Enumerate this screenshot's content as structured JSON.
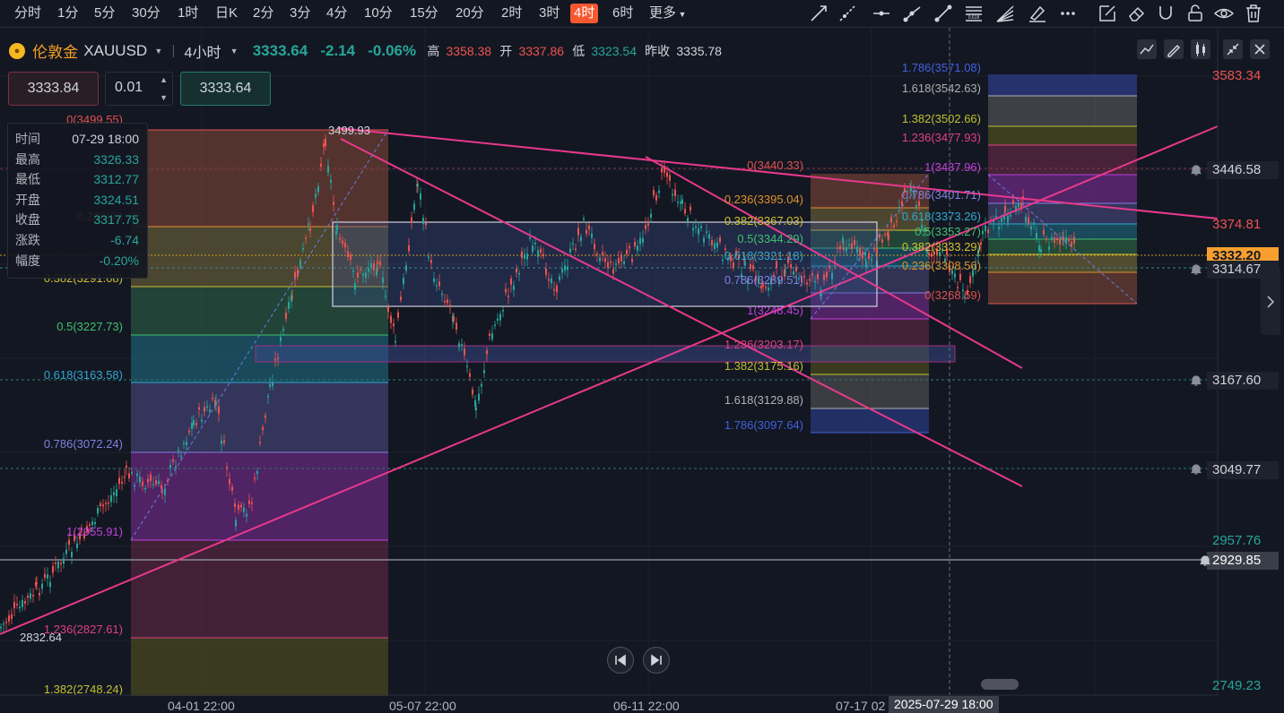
{
  "toolbar": {
    "timeframes": [
      "分时",
      "1分",
      "5分",
      "30分",
      "1时",
      "日K",
      "2分",
      "3分",
      "4分",
      "10分",
      "15分",
      "20分",
      "2时",
      "3时",
      "4时",
      "6时",
      "更多"
    ],
    "active_timeframe": "4时"
  },
  "symbol": {
    "name": "伦敦金",
    "code": "XAUUSD",
    "interval": "4小时",
    "price": "3333.64",
    "change": "-2.14",
    "change_pct": "-0.06%",
    "high_label": "高",
    "high": "3358.38",
    "open_label": "开",
    "open": "3337.86",
    "low_label": "低",
    "low": "3323.54",
    "prev_close_label": "昨收",
    "prev_close": "3335.78"
  },
  "trade": {
    "sell_price": "3333.84",
    "lot": "0.01",
    "buy_price": "3333.64"
  },
  "ohlc_panel": {
    "rows": [
      {
        "k": "时间",
        "v": "07-29 18:00"
      },
      {
        "k": "最高",
        "v": "3326.33"
      },
      {
        "k": "最低",
        "v": "3312.77"
      },
      {
        "k": "开盘",
        "v": "3324.51"
      },
      {
        "k": "收盘",
        "v": "3317.75"
      },
      {
        "k": "涨跌",
        "v": "-6.74"
      },
      {
        "k": "幅度",
        "v": "-0.20%"
      }
    ]
  },
  "price_axis": {
    "top": "3583.34",
    "alert1": "3446.58",
    "level_red": "3374.81",
    "current": "3332.20",
    "alert2": "3314.67",
    "alert3": "3167.60",
    "alert4": "3049.77",
    "green1": "2957.76",
    "alert5": "2929.85",
    "bottom": "2749.23"
  },
  "time_axis": {
    "labels": [
      "04-01 22:00",
      "05-07 22:00",
      "06-11 22:00",
      "07-17 02"
    ],
    "crosshair": "2025-07-29 18:00"
  },
  "annotations": {
    "high_label": "3499.93",
    "low_label": "2832.64"
  },
  "fib1": [
    "0(3499.55)",
    "0.236(33",
    "0.382(3291.08)",
    "0.5(3227.73)",
    "0.618(3163.58)",
    "0.786(3072.24)",
    "1(2955.91)",
    "1.236(2827.61)",
    "1.382(2748.24)"
  ],
  "fib2": [
    "0(3440.33)",
    "0.236(3395.04)",
    "0.382(3367.03)",
    "0.5(3344.29)",
    "0.618(3321.18)",
    "0.786(3289.51)",
    "1(3248.45)",
    "1.236(3203.17)",
    "1.382(3175.16)",
    "1.618(3129.88)",
    "1.786(3097.64)"
  ],
  "fib3": [
    "1.786(3571.08)",
    "1.618(3542.63)",
    "1.382(3502.66)",
    "1.236(3477.93)",
    "1(3437.96)",
    "0.786(3401.71)",
    "0.618(3373.26)",
    "0.5(3353.27)",
    "0.382(3333.29)",
    "0.236(3308.56)",
    "0(3268.59)"
  ],
  "colors": {
    "up": "#26a69a",
    "down": "#ef5350",
    "accent": "#f7582f",
    "trend": "#e8398c"
  }
}
